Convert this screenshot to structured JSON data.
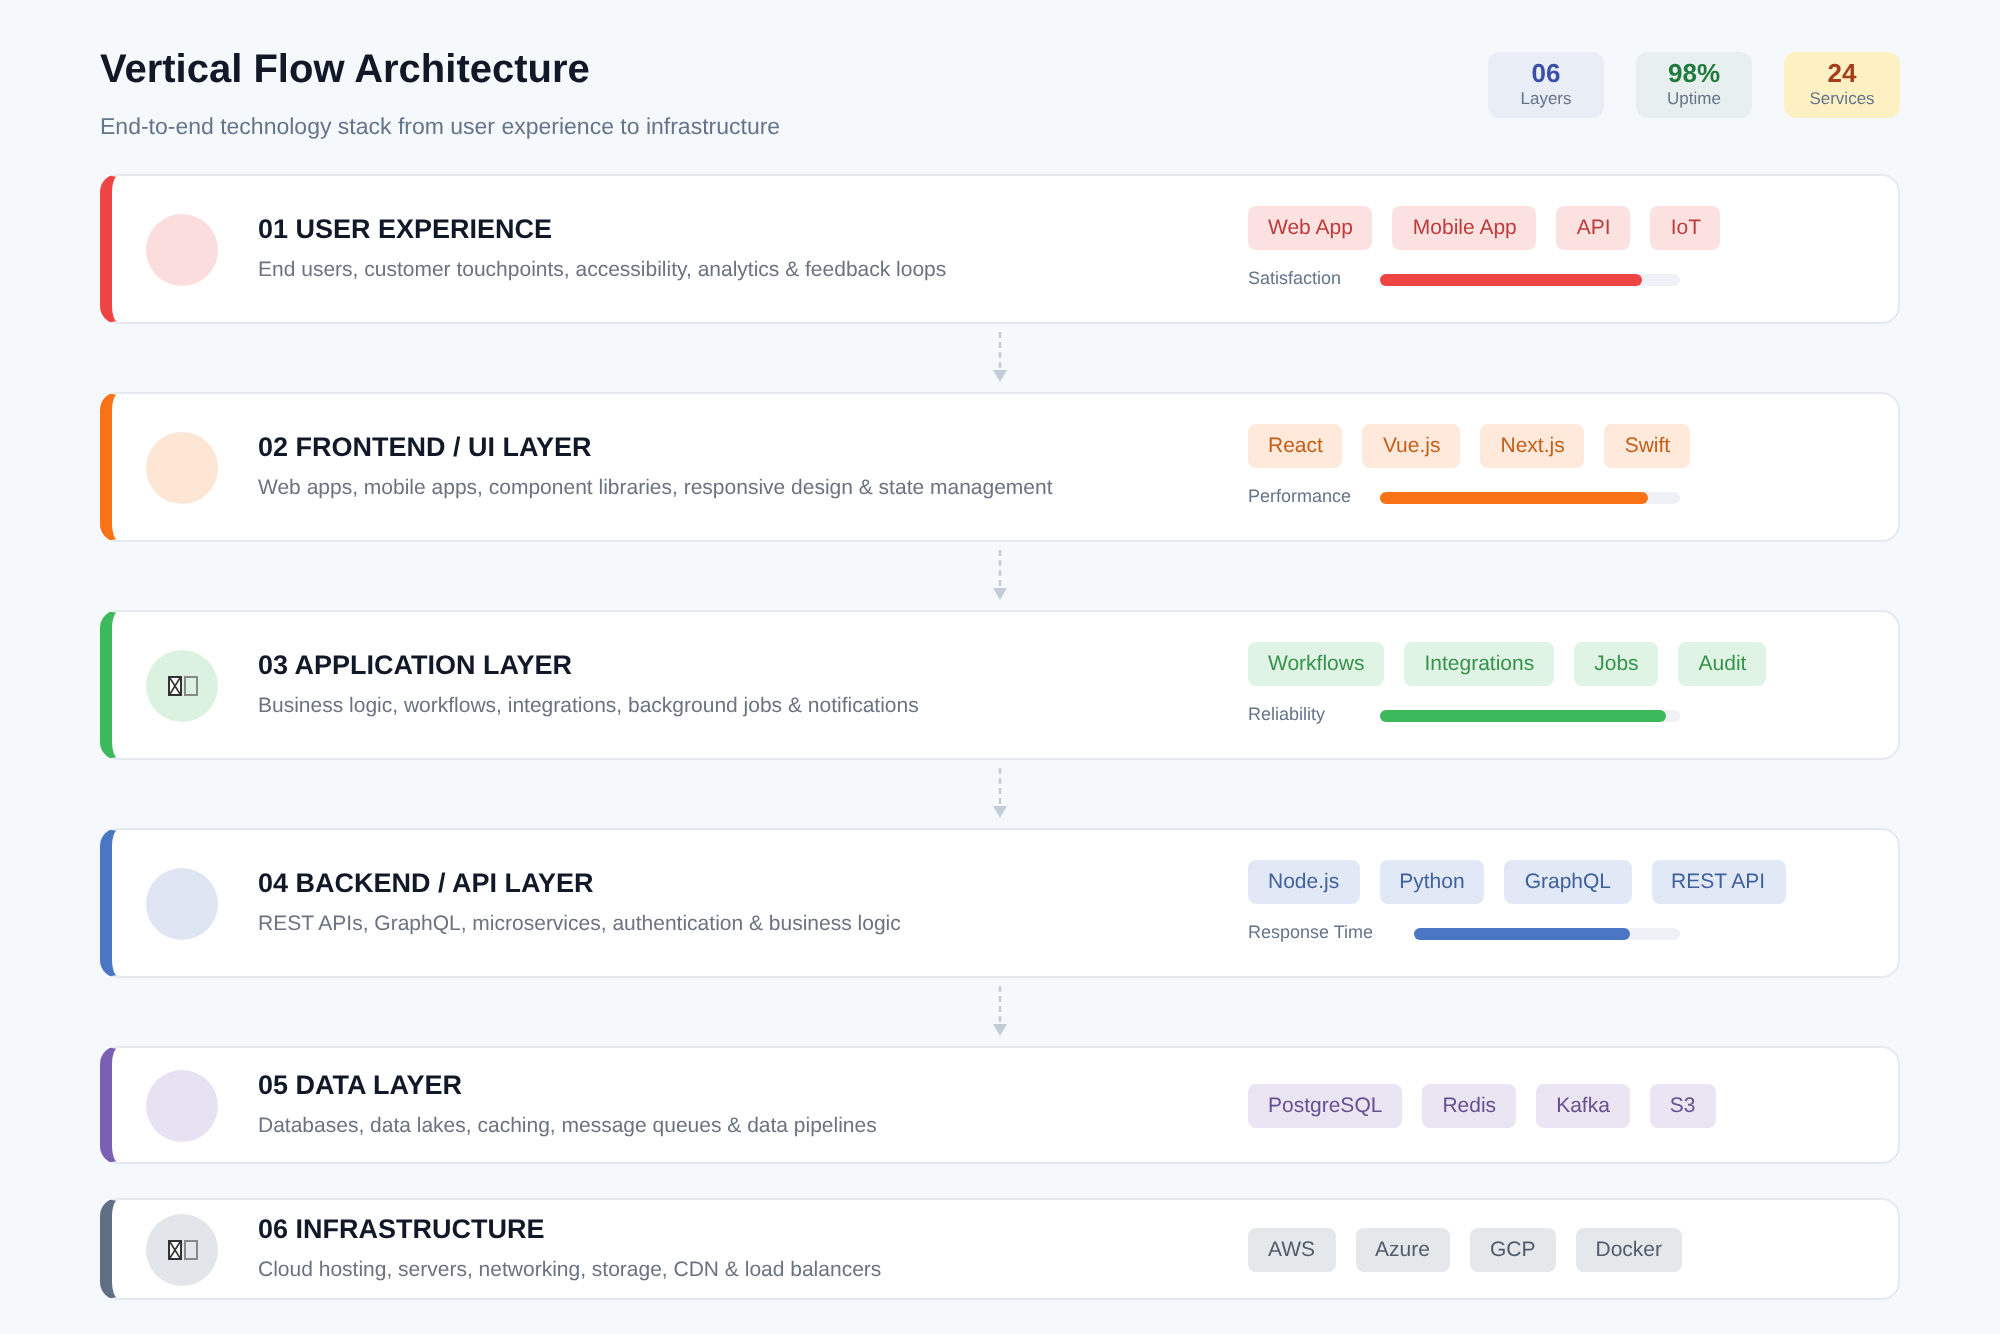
{
  "header": {
    "title": "Vertical Flow Architecture",
    "subtitle": "End-to-end technology stack from user experience to infrastructure"
  },
  "stats": [
    {
      "value": "06",
      "label": "Layers",
      "color": "#3b4fa8",
      "highlighted": false
    },
    {
      "value": "98%",
      "label": "Uptime",
      "color": "#1f7a3c",
      "highlighted": false
    },
    {
      "value": "24",
      "label": "Services",
      "color": "#a63c1c",
      "highlighted": true
    }
  ],
  "layers": [
    {
      "title": "01 USER EXPERIENCE",
      "description": "End users, customer touchpoints, accessibility, analytics & feedback loops",
      "color": "#ef4444",
      "kind": "plain",
      "tags": [
        "Web App",
        "Mobile App",
        "API",
        "IoT"
      ],
      "meter": {
        "label": "Satisfaction",
        "level": 0.87
      },
      "arrow_below": true
    },
    {
      "title": "02 FRONTEND / UI LAYER",
      "description": "Web apps, mobile apps, component libraries, responsive design & state management",
      "color": "#f97316",
      "kind": "plain",
      "tags": [
        "React",
        "Vue.js",
        "Next.js",
        "Swift"
      ],
      "meter": {
        "label": "Performance",
        "level": 0.89
      },
      "arrow_below": true
    },
    {
      "title": "03 APPLICATION LAYER",
      "description": "Business logic, workflows, integrations, background jobs & notifications",
      "color": "#3cb95a",
      "kind": "glyph",
      "tags": [
        "Workflows",
        "Integrations",
        "Jobs",
        "Audit"
      ],
      "meter": {
        "label": "Reliability",
        "level": 0.95
      },
      "arrow_below": true
    },
    {
      "title": "04 BACKEND / API LAYER",
      "description": "REST APIs, GraphQL, microservices, authentication & business logic",
      "color": "#4a76c4",
      "kind": "plain",
      "tags": [
        "Node.js",
        "Python",
        "GraphQL",
        "REST API"
      ],
      "meter": {
        "label": "Response Time",
        "level": 0.81
      },
      "arrow_below": true
    },
    {
      "title": "05 DATA LAYER",
      "description": "Databases, data lakes, caching, message queues & data pipelines",
      "color": "#7b5fb5",
      "kind": "plain",
      "tags": [
        "PostgreSQL",
        "Redis",
        "Kafka",
        "S3"
      ],
      "arrow_below": false
    },
    {
      "title": "06 INFRASTRUCTURE",
      "description": "Cloud hosting, servers, networking, storage, CDN & load balancers",
      "color": "#5f6f85",
      "kind": "glyph",
      "tags": [
        "AWS",
        "Azure",
        "GCP",
        "Docker"
      ]
    }
  ]
}
